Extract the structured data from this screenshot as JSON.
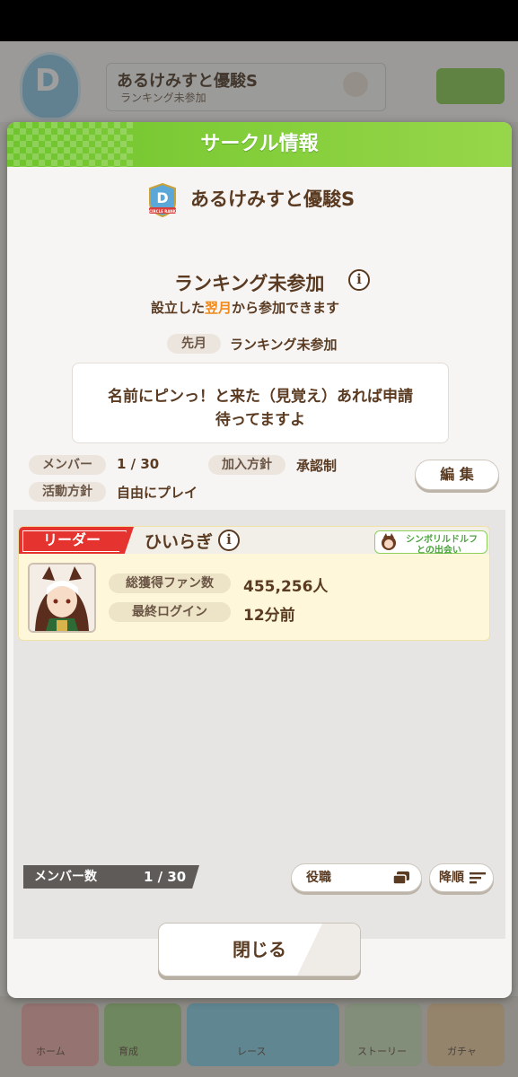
{
  "background": {
    "circle_name": "あるけみすと優駿S",
    "ranking": "ランキング未参加",
    "nav_labels": [
      "ホーム",
      "育成",
      "ストーリー",
      "レース",
      "ガチャ"
    ]
  },
  "dialog": {
    "title": "サークル情報",
    "circle_name": "あるけみすと優駿S",
    "emblem_letter": "D",
    "emblem_rank": "CIRCLE RANK",
    "ranking_status": "ランキング未参加",
    "ranking_note_before": "設立した",
    "ranking_note_highlight": "翌月",
    "ranking_note_after": "から参加できます",
    "last_month_label": "先月",
    "last_month_value": "ランキング未参加",
    "description_line1": "名前にピンっ！と来た（見覚え）あれば申請",
    "description_line2": "待ってますよ",
    "members_label": "メンバー",
    "members_value": "1 / 30",
    "join_policy_label": "加入方針",
    "join_policy_value": "承認制",
    "activity_label": "活動方針",
    "activity_value": "自由にプレイ",
    "edit_button": "編 集",
    "info_glyph": "i"
  },
  "leader_card": {
    "role": "リーダー",
    "name": "ひいらぎ",
    "event_line1": "シンボリルドルフ",
    "event_line2": "との出会い",
    "fans_label": "総獲得ファン数",
    "fans_value": "455,256人",
    "login_label": "最終ログイン",
    "login_value": "12分前"
  },
  "list_footer": {
    "count_label": "メンバー数",
    "count_value": "1 / 30",
    "sort_key_button": "役職",
    "order_button": "降順"
  },
  "close_button": "閉じる",
  "colors": {
    "header_green": "#7cc935",
    "text_brown": "#5a3b22",
    "highlight_orange": "#f08a1c",
    "leader_red": "#e5342f",
    "card_yellow": "#fff7d9"
  }
}
